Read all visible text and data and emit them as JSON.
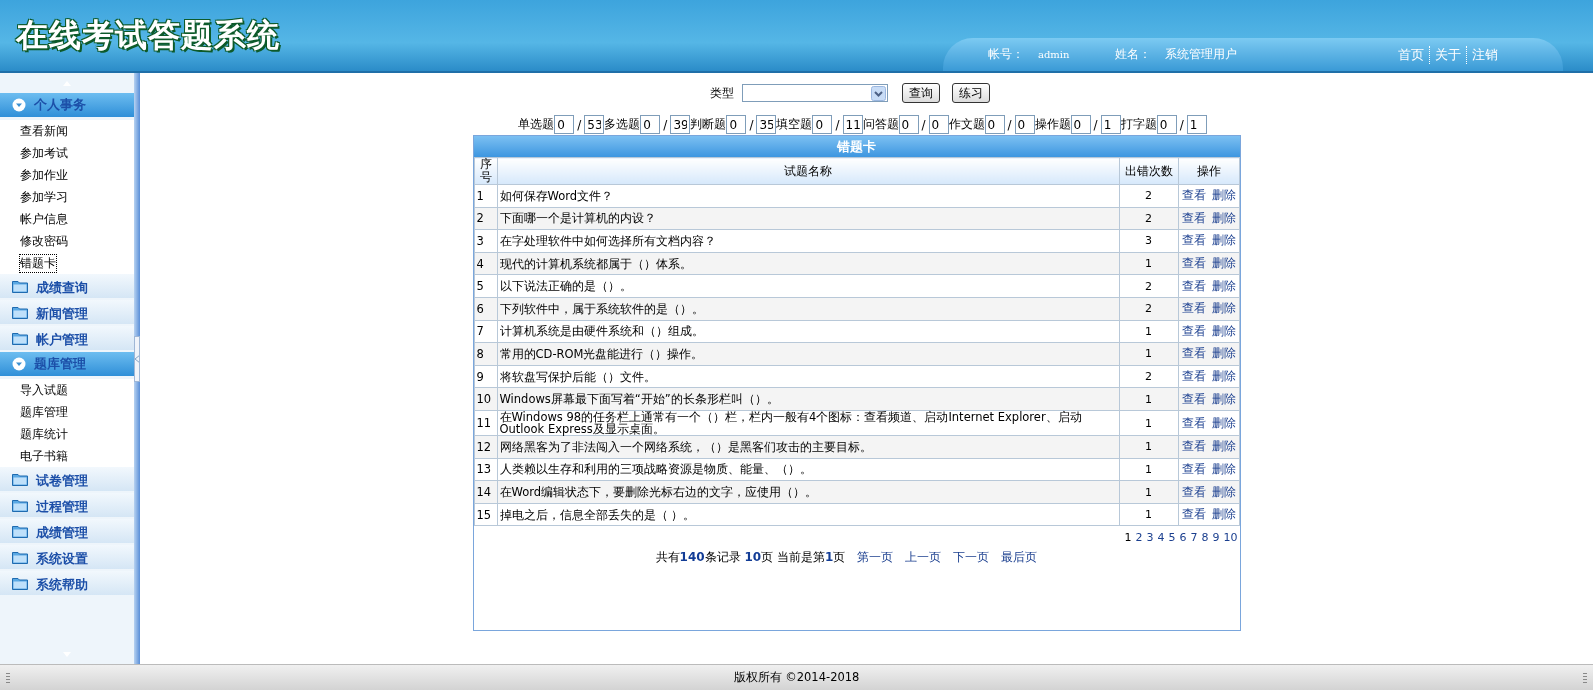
{
  "header": {
    "title": "在线考试答题系统",
    "account_label": "帐号：",
    "account": "admin",
    "name_label": "姓名：",
    "name": "系统管理用户",
    "links": [
      "首页",
      "关于",
      "注销"
    ]
  },
  "sidebar": {
    "groups": [
      {
        "title": "个人事务",
        "expanded": true,
        "items": [
          {
            "label": "查看新闻",
            "selected": false
          },
          {
            "label": "参加考试",
            "selected": false
          },
          {
            "label": "参加作业",
            "selected": false
          },
          {
            "label": "参加学习",
            "selected": false
          },
          {
            "label": "帐户信息",
            "selected": false
          },
          {
            "label": "修改密码",
            "selected": false
          },
          {
            "label": "错题卡",
            "selected": true
          }
        ]
      },
      {
        "title": "成绩查询",
        "expanded": false
      },
      {
        "title": "新闻管理",
        "expanded": false
      },
      {
        "title": "帐户管理",
        "expanded": false
      },
      {
        "title": "题库管理",
        "expanded": true,
        "items": [
          {
            "label": "导入试题",
            "selected": false
          },
          {
            "label": "题库管理",
            "selected": false
          },
          {
            "label": "题库统计",
            "selected": false
          },
          {
            "label": "电子书籍",
            "selected": false
          }
        ]
      },
      {
        "title": "试卷管理",
        "expanded": false
      },
      {
        "title": "过程管理",
        "expanded": false
      },
      {
        "title": "成绩管理",
        "expanded": false
      },
      {
        "title": "系统设置",
        "expanded": false
      },
      {
        "title": "系统帮助",
        "expanded": false
      }
    ]
  },
  "filter": {
    "type_label": "类型",
    "buttons": [
      "查询",
      "练习"
    ]
  },
  "stats": [
    {
      "label": "单选题",
      "value": "0",
      "total": "53"
    },
    {
      "label": "多选题",
      "value": "0",
      "total": "39"
    },
    {
      "label": "判断题",
      "value": "0",
      "total": "35"
    },
    {
      "label": "填空题",
      "value": "0",
      "total": "11"
    },
    {
      "label": "问答题",
      "value": "0",
      "total": "0"
    },
    {
      "label": "作文题",
      "value": "0",
      "total": "0"
    },
    {
      "label": "操作题",
      "value": "0",
      "total": "1"
    },
    {
      "label": "打字题",
      "value": "0",
      "total": "1"
    }
  ],
  "stats_separator": "/",
  "table": {
    "title": "错题卡",
    "columns": [
      "序号",
      "试题名称",
      "出错次数",
      "操作"
    ],
    "rows": [
      {
        "no": "1",
        "name": "如何保存Word文件？",
        "count": "2",
        "actions": [
          "查看",
          "删除"
        ]
      },
      {
        "no": "2",
        "name": "下面哪一个是计算机的内设？",
        "count": "2",
        "actions": [
          "查看",
          "删除"
        ]
      },
      {
        "no": "3",
        "name": "在字处理软件中如何选择所有文档内容？",
        "count": "3",
        "actions": [
          "查看",
          "删除"
        ]
      },
      {
        "no": "4",
        "name": "现代的计算机系统都属于（）体系。",
        "count": "1",
        "actions": [
          "查看",
          "删除"
        ]
      },
      {
        "no": "5",
        "name": "以下说法正确的是（）。",
        "count": "2",
        "actions": [
          "查看",
          "删除"
        ]
      },
      {
        "no": "6",
        "name": "下列软件中，属于系统软件的是（）。",
        "count": "2",
        "actions": [
          "查看",
          "删除"
        ]
      },
      {
        "no": "7",
        "name": "计算机系统是由硬件系统和（）组成。",
        "count": "1",
        "actions": [
          "查看",
          "删除"
        ]
      },
      {
        "no": "8",
        "name": "常用的CD-ROM光盘能进行（）操作。",
        "count": "1",
        "actions": [
          "查看",
          "删除"
        ]
      },
      {
        "no": "9",
        "name": "将软盘写保护后能（）文件。",
        "count": "2",
        "actions": [
          "查看",
          "删除"
        ]
      },
      {
        "no": "10",
        "name": "Windows屏幕最下面写着“开始”的长条形栏叫（）。",
        "count": "1",
        "actions": [
          "查看",
          "删除"
        ]
      },
      {
        "no": "11",
        "name": "在Windows 98的任务栏上通常有一个（）栏，栏内一般有4个图标：查看频道、启动Internet Explorer、启动Outlook Express及显示桌面。",
        "count": "1",
        "actions": [
          "查看",
          "删除"
        ]
      },
      {
        "no": "12",
        "name": "网络黑客为了非法闯入一个网络系统，（）是黑客们攻击的主要目标。",
        "count": "1",
        "actions": [
          "查看",
          "删除"
        ]
      },
      {
        "no": "13",
        "name": "人类赖以生存和利用的三项战略资源是物质、能量、（）。",
        "count": "1",
        "actions": [
          "查看",
          "删除"
        ]
      },
      {
        "no": "14",
        "name": "在Word编辑状态下，要删除光标右边的文字，应使用（）。",
        "count": "1",
        "actions": [
          "查看",
          "删除"
        ]
      },
      {
        "no": "15",
        "name": "掉电之后，信息全部丢失的是（  ）。",
        "count": "1",
        "actions": [
          "查看",
          "删除"
        ]
      }
    ],
    "pages": [
      {
        "label": "1",
        "selected": true
      },
      {
        "label": "2",
        "selected": false
      },
      {
        "label": "3",
        "selected": false
      },
      {
        "label": "4",
        "selected": false
      },
      {
        "label": "5",
        "selected": false
      },
      {
        "label": "6",
        "selected": false
      },
      {
        "label": "7",
        "selected": false
      },
      {
        "label": "8",
        "selected": false
      },
      {
        "label": "9",
        "selected": false
      },
      {
        "label": "10",
        "selected": false
      }
    ],
    "summary": "共有**140**条记录 **10**页 当前是第**1**页",
    "nav": [
      "第一页",
      "上一页",
      "下一页",
      "最后页"
    ]
  },
  "footer": "版权所有 ©2014-2018"
}
